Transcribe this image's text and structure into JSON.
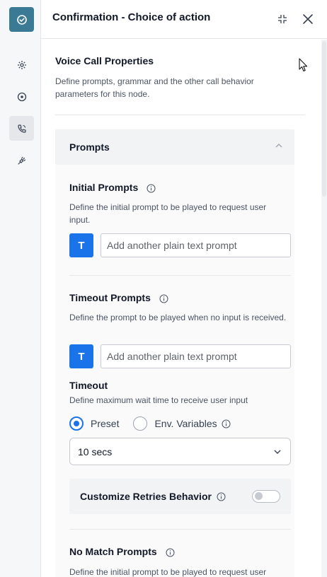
{
  "header": {
    "title": "Confirmation - Choice of action",
    "collapse_icon": "collapse-icon",
    "close_icon": "close-icon"
  },
  "rail": {
    "logo_icon": "check-circle-icon",
    "items": [
      {
        "icon": "gear-icon"
      },
      {
        "icon": "target-icon"
      },
      {
        "icon": "phone-call-icon",
        "active": true
      },
      {
        "icon": "plug-icon"
      }
    ]
  },
  "section": {
    "title": "Voice Call Properties",
    "description": "Define prompts, grammar and the other call behavior parameters for this node."
  },
  "prompts": {
    "title": "Prompts",
    "initial": {
      "title": "Initial Prompts",
      "description": "Define the initial prompt to be played to request user input.",
      "text_button": "T",
      "placeholder": "Add another plain text prompt"
    },
    "timeout_prompts": {
      "title": "Timeout Prompts",
      "description": "Define the prompt to be played when no input is received.",
      "text_button": "T",
      "placeholder": "Add another plain text prompt"
    },
    "timeout": {
      "title": "Timeout",
      "description": "Define maximum wait time to receive user input",
      "options": [
        "Preset",
        "Env. Variables"
      ],
      "selected_option": "Preset",
      "value": "10 secs"
    },
    "retries": {
      "label": "Customize Retries Behavior",
      "enabled": false
    },
    "no_match": {
      "title": "No Match Prompts",
      "description": "Define the initial prompt to be played to request user"
    }
  },
  "colors": {
    "accent": "#1a73e8",
    "logo_bg": "#3b7a94"
  }
}
